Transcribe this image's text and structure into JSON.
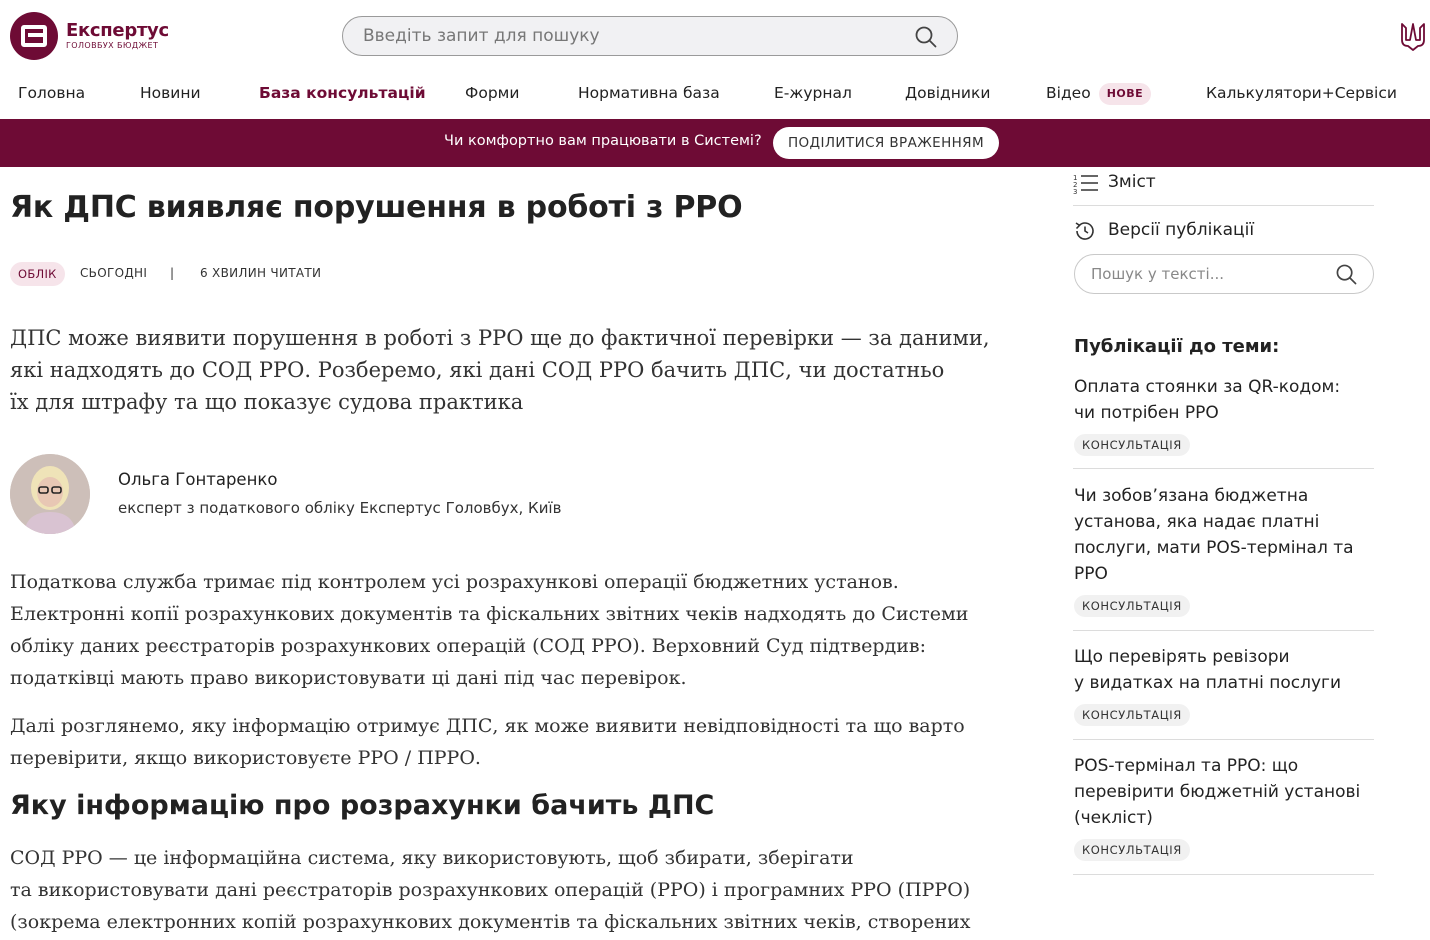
{
  "brand": {
    "name": "Експертус",
    "subtitle": "ГОЛОВБУХ БЮДЖЕТ",
    "color": "#6e0b35"
  },
  "search": {
    "placeholder": "Введіть запит для пошуку"
  },
  "nav": {
    "items": [
      {
        "label": "Головна"
      },
      {
        "label": "Новини"
      },
      {
        "label": "База консультацій",
        "active": true
      },
      {
        "label": "Форми"
      },
      {
        "label": "Нормативна база"
      },
      {
        "label": "Е-журнал"
      },
      {
        "label": "Довідники"
      },
      {
        "label": "Відео",
        "badge": "НОВЕ"
      },
      {
        "label": "Калькулятори+Сервіси"
      }
    ]
  },
  "banner": {
    "text": "Чи комфортно вам працювати в Системі?",
    "button": "ПОДІЛИТИСЯ ВРАЖЕННЯМ"
  },
  "article": {
    "title": "Як ДПС виявляє порушення в роботі з РРО",
    "tag": "ОБЛІК",
    "date": "СЬОГОДНІ",
    "separator": "|",
    "read_time": "6 ХВИЛИН ЧИТАТИ",
    "lead": [
      "ДПС може виявити порушення в роботі з РРО ще до фактичної перевірки — за даними,",
      "які надходять до СОД РРО. Розберемо, які дані СОД РРО бачить ДПС, чи достатньо",
      "їх для штрафу та що показує судова практика"
    ],
    "author": {
      "name": "Ольга Гонтаренко",
      "position": "експерт з податкового обліку Експертус Головбух, Київ"
    },
    "paragraphs": [
      [
        "Податкова служба тримає під контролем усі розрахункові операції бюджетних установ.",
        "Електронні копії розрахункових документів та фіскальних звітних чеків надходять до Системи",
        "обліку даних реєстраторів розрахункових операцій (СОД РРО). Верховний Суд підтвердив:",
        "податківці мають право використовувати ці дані під час перевірок."
      ],
      [
        "Далі розглянемо, яку інформацію отримує ДПС, як може виявити невідповідності та що варто",
        "перевірити, якщо використовуєте РРО / ПРРО."
      ]
    ],
    "h2": "Яку інформацію про розрахунки бачить ДПС",
    "paragraph3": [
      "СОД РРО — це інформаційна система, яку використовують, щоб збирати, зберігати",
      "та використовувати дані реєстраторів розрахункових операцій (РРО) і програмних РРО (ПРРО)",
      "(зокрема електронних копій розрахункових документів та фіскальних звітних чеків, створених"
    ]
  },
  "sidebar": {
    "contents_label": "Зміст",
    "versions_label": "Версії публікації",
    "search_placeholder": "Пошук у тексті...",
    "related_title": "Публікації до теми:",
    "related": [
      {
        "lines": [
          "Оплата стоянки за QR-кодом:",
          "чи потрібен РРО"
        ],
        "tag": "КОНСУЛЬТАЦІЯ"
      },
      {
        "lines": [
          "Чи зобов’язана бюджетна",
          "установа, яка надає платні",
          "послуги, мати POS-термінал та",
          "РРО"
        ],
        "tag": "КОНСУЛЬТАЦІЯ"
      },
      {
        "lines": [
          "Що перевірять ревізори",
          "у видатках на платні послуги"
        ],
        "tag": "КОНСУЛЬТАЦІЯ"
      },
      {
        "lines": [
          "POS-термінал та РРО: що",
          "перевірити бюджетній установі",
          "(чекліст)"
        ],
        "tag": "КОНСУЛЬТАЦІЯ"
      }
    ]
  }
}
